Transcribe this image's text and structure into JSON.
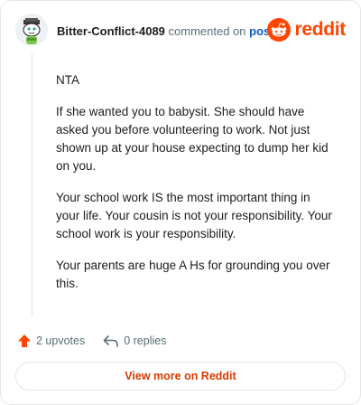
{
  "header": {
    "username": "Bitter-Conflict-4089",
    "commented_text": "commented on",
    "post_link": "post",
    "brand": "reddit",
    "avatar_icon": "avatar-snoo-icon",
    "brand_icon": "reddit-logo-icon"
  },
  "comment": {
    "paragraphs": [
      "NTA",
      "If she wanted you to babysit. She should have asked you before volunteering to work. Not just shown up at your house expecting to dump her kid on you.",
      "Your school work IS the most important thing in your life. Your cousin is not your responsibility. Your school work is your responsibility.",
      "Your parents are huge A Hs for grounding you over this."
    ]
  },
  "actions": {
    "upvotes": "2 upvotes",
    "replies": "0 replies",
    "upvote_icon": "upvote-arrow-icon",
    "reply_icon": "reply-arrow-icon"
  },
  "view_more_label": "View more on Reddit",
  "colors": {
    "brand": "#ff4500",
    "link": "#0a5cc2",
    "view_more": "#d93a00",
    "muted": "#576f76"
  }
}
